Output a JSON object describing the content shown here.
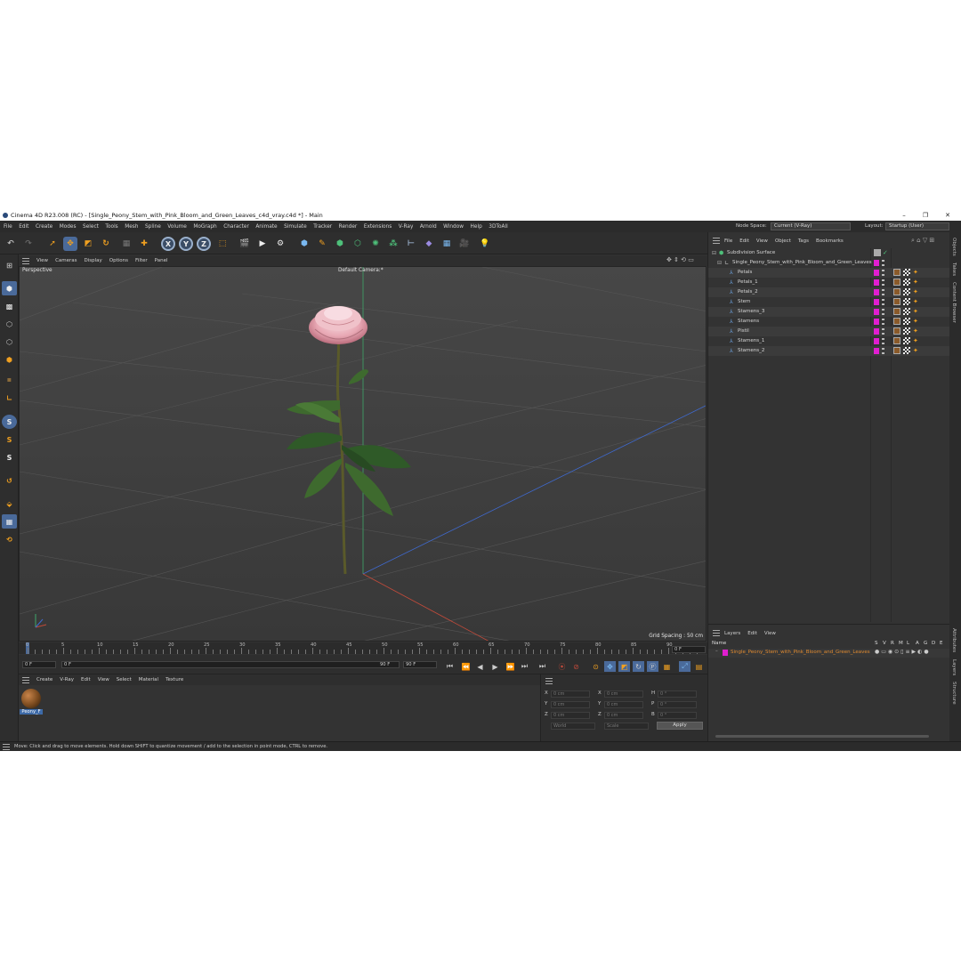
{
  "window": {
    "title": "Cinema 4D R23.008 (RC) - [Single_Peony_Stem_with_Pink_Bloom_and_Green_Leaves_c4d_vray.c4d *] - Main",
    "min": "–",
    "max": "❐",
    "close": "✕"
  },
  "menubar": {
    "items": [
      "File",
      "Edit",
      "Create",
      "Modes",
      "Select",
      "Tools",
      "Mesh",
      "Spline",
      "Volume",
      "MoGraph",
      "Character",
      "Animate",
      "Simulate",
      "Tracker",
      "Render",
      "Extensions",
      "V-Ray",
      "Arnold",
      "Window",
      "Help",
      "3DToAll"
    ],
    "node_space_label": "Node Space:",
    "node_space_value": "Current (V-Ray)",
    "layout_label": "Layout:",
    "layout_value": "Startup (User)"
  },
  "toolbar": {
    "axis_x": "X",
    "axis_y": "Y",
    "axis_z": "Z"
  },
  "viewport": {
    "menu": [
      "View",
      "Cameras",
      "Display",
      "Options",
      "Filter",
      "Panel"
    ],
    "mode_label": "Perspective",
    "camera_label": "Default Camera",
    "camera_suffix": ":*",
    "grid_spacing": "Grid Spacing : 50 cm"
  },
  "timeline": {
    "ticks": [
      "0",
      "5",
      "10",
      "15",
      "20",
      "25",
      "30",
      "35",
      "40",
      "45",
      "50",
      "55",
      "60",
      "65",
      "70",
      "75",
      "80",
      "85",
      "90"
    ],
    "current_frame": "0 F",
    "start_frame": "0 F",
    "range_start": "0 F",
    "range_end": "90 F",
    "end_frame": "90 F",
    "end_frame2": "90 F"
  },
  "material_manager": {
    "menu": [
      "Create",
      "V-Ray",
      "Edit",
      "View",
      "Select",
      "Material",
      "Texture"
    ],
    "materials": [
      {
        "name": "Peony_F"
      }
    ]
  },
  "coordinates": {
    "pos_labels": [
      "X",
      "Y",
      "Z"
    ],
    "size_labels": [
      "X",
      "Y",
      "Z"
    ],
    "rot_labels": [
      "H",
      "P",
      "B"
    ],
    "pos_values": [
      "0 cm",
      "0 cm",
      "0 cm"
    ],
    "size_values": [
      "0 cm",
      "0 cm",
      "0 cm"
    ],
    "rot_values": [
      "0 °",
      "0 °",
      "0 °"
    ],
    "space": "World",
    "mode": "Scale",
    "apply": "Apply"
  },
  "objects_panel": {
    "menu": [
      "File",
      "Edit",
      "View",
      "Object",
      "Tags",
      "Bookmarks"
    ],
    "tree": [
      {
        "name": "Subdivision Surface",
        "level": 0
      },
      {
        "name": "Single_Peony_Stem_with_Pink_Bloom_and_Green_Leaves",
        "level": 1
      },
      {
        "name": "Petals",
        "level": 2
      },
      {
        "name": "Petals_1",
        "level": 2
      },
      {
        "name": "Petals_2",
        "level": 2
      },
      {
        "name": "Stem",
        "level": 2
      },
      {
        "name": "Stamens_3",
        "level": 2
      },
      {
        "name": "Stamens",
        "level": 2
      },
      {
        "name": "Pistil",
        "level": 2
      },
      {
        "name": "Stamens_1",
        "level": 2
      },
      {
        "name": "Stamens_2",
        "level": 2
      }
    ]
  },
  "layers_panel": {
    "menu": [
      "Layers",
      "Edit",
      "View"
    ],
    "header_name": "Name",
    "header_cols": [
      "S",
      "V",
      "R",
      "M",
      "L",
      "A",
      "G",
      "D",
      "E"
    ],
    "layers": [
      {
        "name": "Single_Peony_Stem_with_Pink_Bloom_and_Green_Leaves",
        "color": "#e01ed0"
      }
    ]
  },
  "side_tabs": [
    "Objects",
    "Takes",
    "Content Browser",
    "Attributes",
    "Layers",
    "Structure"
  ],
  "status": {
    "text": "Move: Click and drag to move elements. Hold down SHIFT to quantize movement / add to the selection in point mode, CTRL to remove."
  },
  "colors": {
    "accent": "#4a6a9a",
    "layer_magenta": "#e01ed0",
    "orange": "#f0a020"
  }
}
